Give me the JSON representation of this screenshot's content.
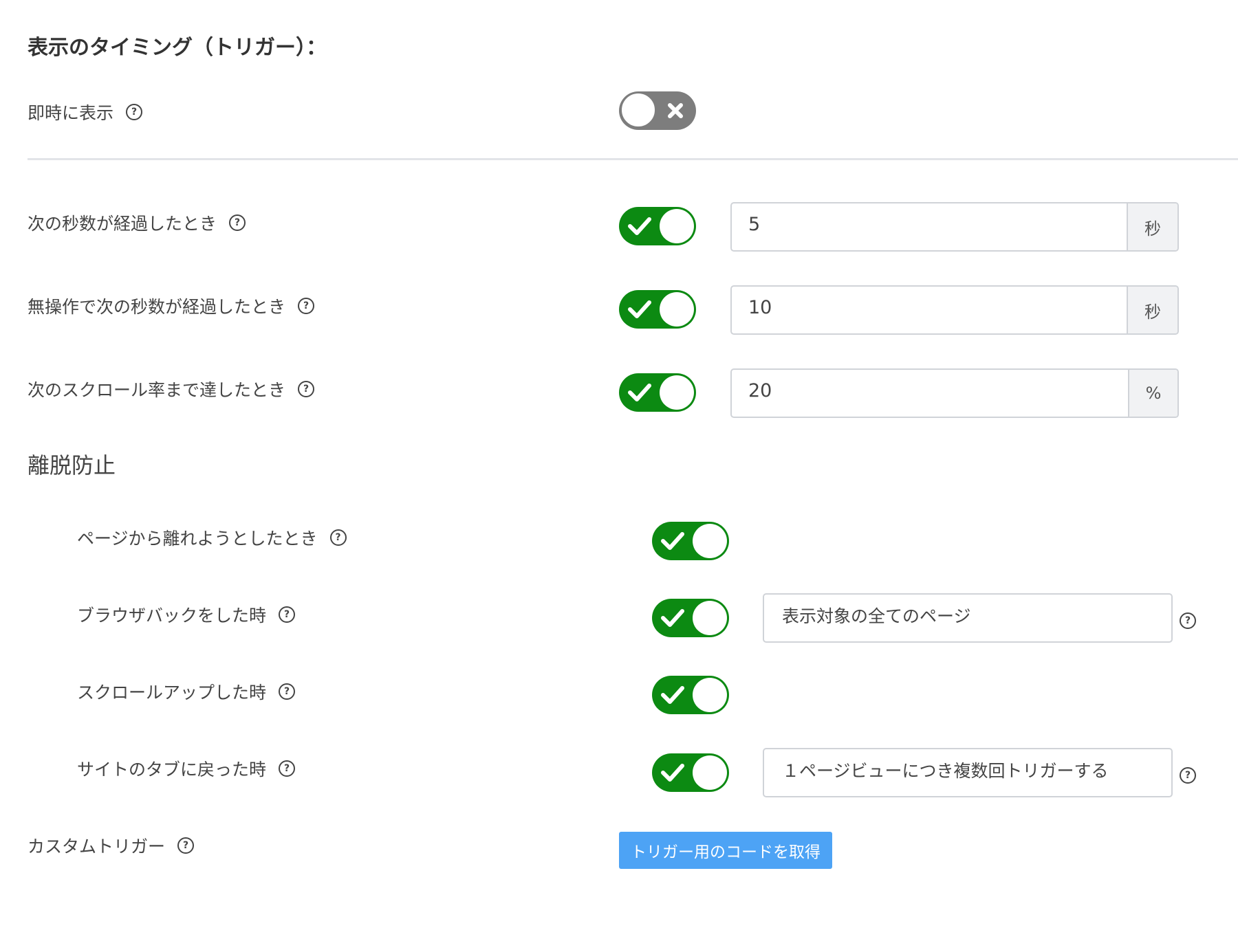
{
  "section_title": "表示のタイミング（トリガー）：",
  "immediate": {
    "label": "即時に表示",
    "enabled": false
  },
  "triggers": [
    {
      "label": "次の秒数が経過したとき",
      "enabled": true,
      "value": "5",
      "unit": "秒"
    },
    {
      "label": "無操作で次の秒数が経過したとき",
      "enabled": true,
      "value": "10",
      "unit": "秒"
    },
    {
      "label": "次のスクロール率まで達したとき",
      "enabled": true,
      "value": "20",
      "unit": "%"
    }
  ],
  "exit_prevention": {
    "title": "離脱防止",
    "items": [
      {
        "label": "ページから離れようとしたとき",
        "enabled": true
      },
      {
        "label": "ブラウザバックをした時",
        "enabled": true,
        "option": "表示対象の全てのページ"
      },
      {
        "label": "スクロールアップした時",
        "enabled": true
      },
      {
        "label": "サイトのタブに戻った時",
        "enabled": true,
        "option": "１ページビューにつき複数回トリガーする"
      }
    ]
  },
  "custom_trigger": {
    "label": "カスタムトリガー",
    "button_label": "トリガー用のコードを取得"
  },
  "help_glyph": "?",
  "colors": {
    "toggle_on": "#0c8a12",
    "toggle_off": "#7d7d7d",
    "button": "#4da3f5"
  }
}
